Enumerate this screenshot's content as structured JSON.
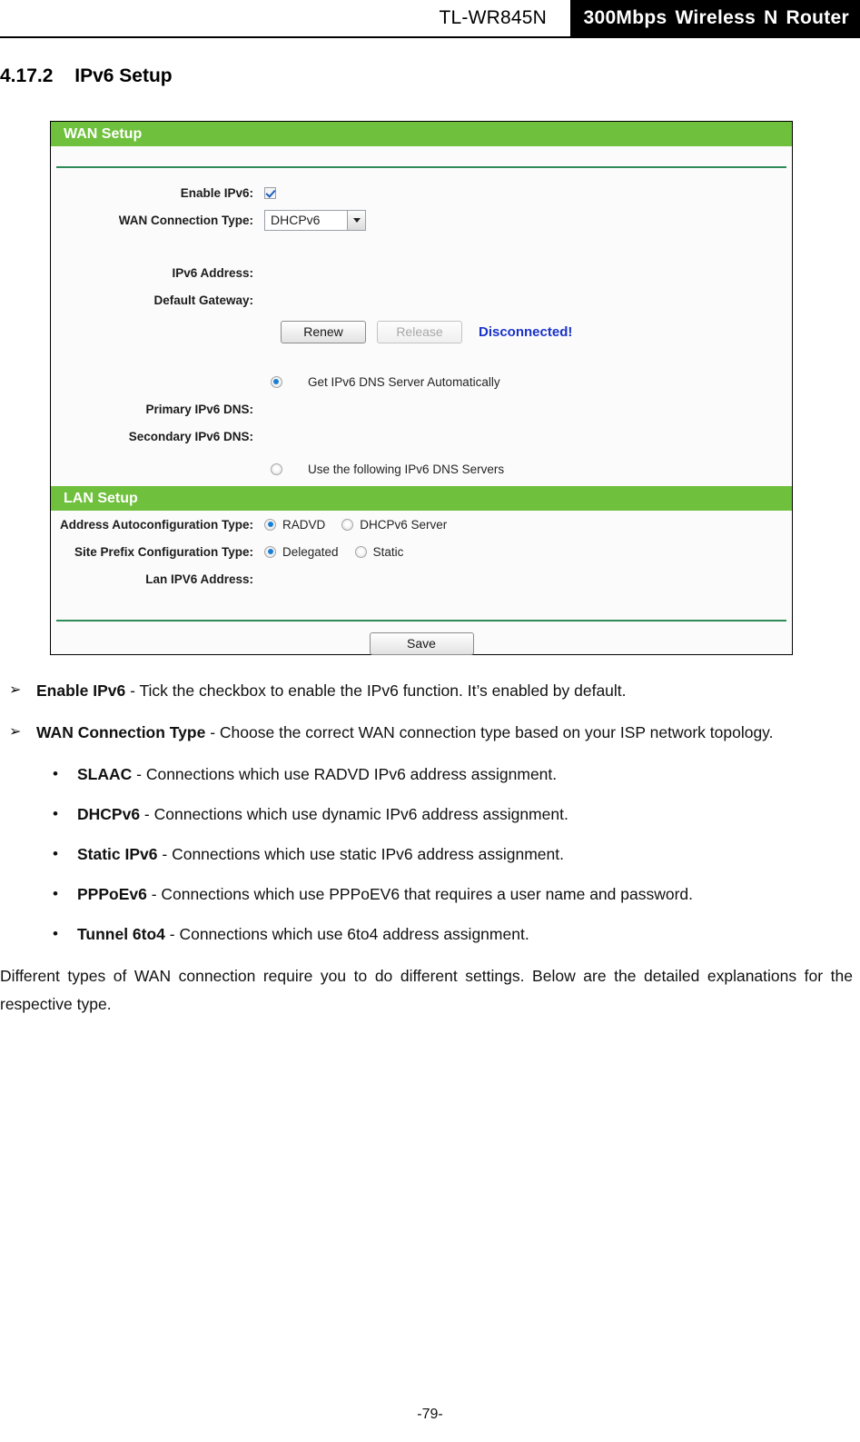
{
  "header": {
    "model": "TL-WR845N",
    "product_words": [
      "300Mbps",
      "Wireless",
      "N",
      "Router"
    ]
  },
  "section": {
    "number": "4.17.2",
    "title": "IPv6 Setup"
  },
  "router_ui": {
    "wan_setup": {
      "panel_title": "WAN Setup",
      "enable_ipv6_label": "Enable IPv6:",
      "enable_ipv6_checked": "true",
      "wan_connection_type_label": "WAN Connection Type:",
      "wan_connection_type_value": "DHCPv6",
      "ipv6_address_label": "IPv6 Address:",
      "ipv6_address_value": "",
      "default_gateway_label": "Default Gateway:",
      "default_gateway_value": "",
      "renew_button": "Renew",
      "release_button": "Release",
      "status": "Disconnected!",
      "dns_auto_option": "Get IPv6 DNS Server Automatically",
      "primary_dns_label": "Primary IPv6 DNS:",
      "primary_dns_value": "",
      "secondary_dns_label": "Secondary IPv6 DNS:",
      "secondary_dns_value": "",
      "dns_manual_option": "Use the following IPv6 DNS Servers"
    },
    "lan_setup": {
      "panel_title": "LAN Setup",
      "address_autoconfig_label": "Address Autoconfiguration Type:",
      "address_autoconfig_options": [
        "RADVD",
        "DHCPv6 Server"
      ],
      "site_prefix_label": "Site Prefix Configuration Type:",
      "site_prefix_options": [
        "Delegated",
        "Static"
      ],
      "lan_ipv6_address_label": "Lan IPV6 Address:",
      "lan_ipv6_address_value": ""
    },
    "save_button": "Save",
    "accent_green": "#6fc03c",
    "status_blue": "#1a33c9"
  },
  "content": {
    "arrow_marker": "➢",
    "dot_marker": "•",
    "bullets": [
      {
        "term": "Enable IPv6",
        "text": " - Tick the checkbox to enable the IPv6 function. It’s enabled by default."
      },
      {
        "term": "WAN Connection Type",
        "text": " - Choose the correct WAN connection type based on your ISP network topology."
      }
    ],
    "sub_bullets": [
      {
        "term": "SLAAC",
        "text": " - Connections which use RADVD IPv6 address assignment."
      },
      {
        "term": "DHCPv6",
        "text": " - Connections which use dynamic IPv6 address assignment."
      },
      {
        "term": "Static IPv6",
        "text": " - Connections which use static IPv6 address assignment."
      },
      {
        "term": "PPPoEv6",
        "text": " - Connections which use PPPoEV6 that requires a user name and password."
      },
      {
        "term": "Tunnel 6to4",
        "text": " - Connections which use 6to4 address assignment."
      }
    ],
    "paragraph": "Different types of WAN connection require you to do different settings. Below are the detailed explanations for the respective type."
  },
  "footer": {
    "page_number": "-79-"
  }
}
